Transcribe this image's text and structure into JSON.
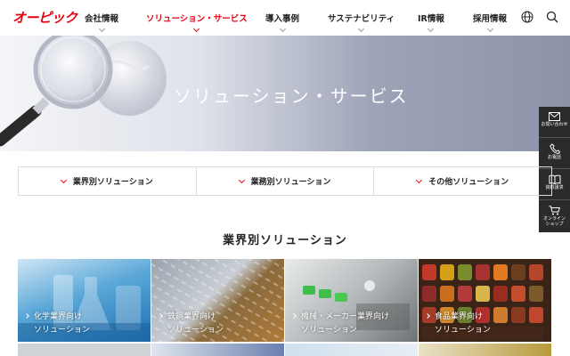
{
  "header": {
    "logo_text": "オーピック",
    "nav": [
      {
        "label": "会社情報"
      },
      {
        "label": "ソリューション・サービス"
      },
      {
        "label": "導入事例"
      },
      {
        "label": "サステナビリティ"
      },
      {
        "label": "IR情報"
      },
      {
        "label": "採用情報"
      }
    ],
    "active_nav": "ソリューション・サービス"
  },
  "hero": {
    "title": "ソリューション・サービス"
  },
  "side_menu": [
    {
      "label": "お問い合わせ",
      "icon": "mail-icon"
    },
    {
      "label": "お電話",
      "icon": "phone-icon"
    },
    {
      "label": "資料請求",
      "icon": "book-icon"
    },
    {
      "label": "オンライン\nショップ",
      "icon": "cart-icon"
    }
  ],
  "tabs": [
    {
      "label": "業界別ソリューション"
    },
    {
      "label": "業務別ソリューション"
    },
    {
      "label": "その他ソリューション"
    }
  ],
  "section": {
    "title": "業界別ソリューション"
  },
  "cards": [
    {
      "line1": "化学業界向け",
      "line2": "ソリューション"
    },
    {
      "line1": "鉄鋼業界向け",
      "line2": "ソリューション"
    },
    {
      "line1": "機械・メーカー業界向け",
      "line2": "ソリューション"
    },
    {
      "line1": "食品業界向け",
      "line2": "ソリューション"
    }
  ],
  "colors": {
    "brand_red": "#e60012",
    "side_bg": "#2b2b2b"
  }
}
